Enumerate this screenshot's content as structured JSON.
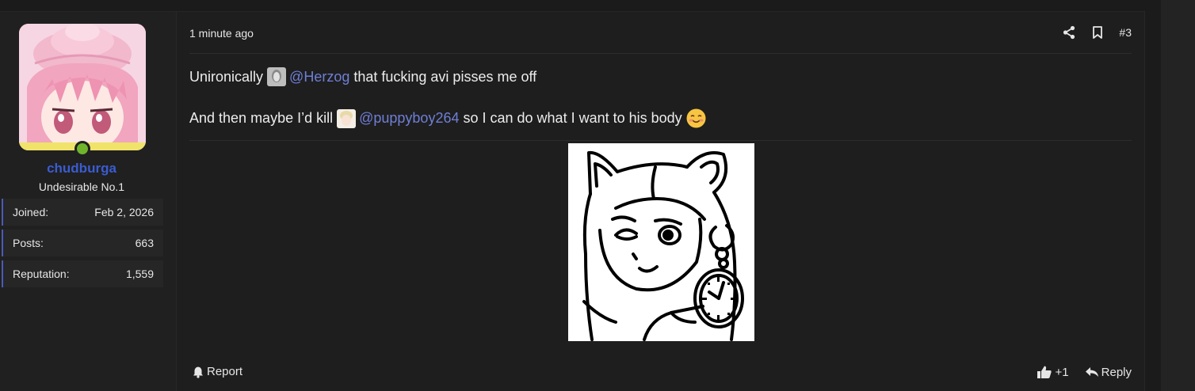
{
  "user": {
    "name": "chudburga",
    "title": "Undesirable No.1",
    "avatar_icon": "avatar-pink-hair-girl",
    "online": true,
    "stats": [
      {
        "label": "Joined:",
        "value": "Feb 2, 2026"
      },
      {
        "label": "Posts:",
        "value": "663"
      },
      {
        "label": "Reputation:",
        "value": "1,559"
      }
    ]
  },
  "post": {
    "time": "1 minute ago",
    "number": "#3",
    "header_icons": [
      "share-icon",
      "bookmark-icon"
    ],
    "line1": {
      "before": "Unironically",
      "mention": "@Herzog",
      "after": "that fucking avi pisses me off"
    },
    "line2": {
      "before": "And then maybe I’d kill",
      "mention": "@puppyboy264",
      "after": "so I can do what I want to his body",
      "emoji": "smiling-face-with-hearts-emoji"
    },
    "attachment_icon": "cartoon-cat-girl-holding-pocket-watch"
  },
  "footer": {
    "report_label": "Report",
    "like_count": "+1",
    "reply_label": "Reply"
  },
  "colors": {
    "username": "#3b5cd1",
    "mention": "#6f7fd6",
    "stat_accent": "#4a5bb8",
    "online": "#6fb52b"
  }
}
